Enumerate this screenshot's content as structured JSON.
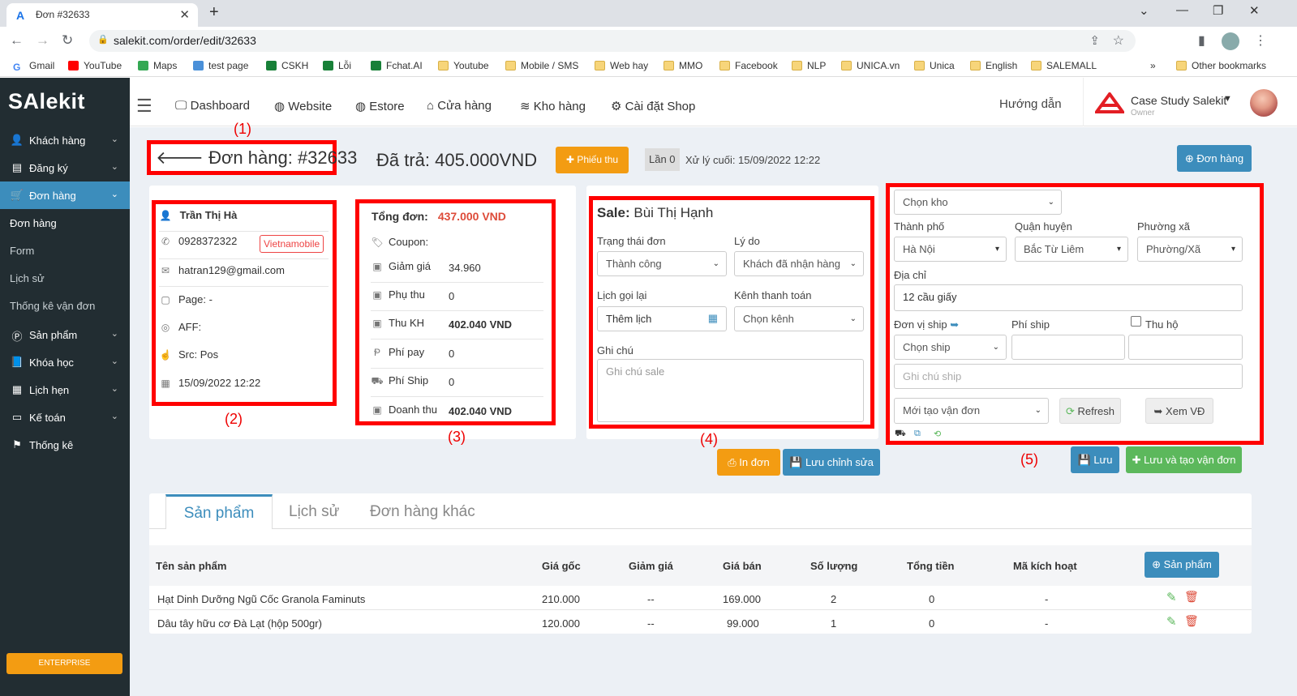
{
  "browser": {
    "tab_title": "Đơn #32633",
    "url": "salekit.com/order/edit/32633",
    "bookmarks": [
      "Gmail",
      "YouTube",
      "Maps",
      "test page",
      "CSKH",
      "Lỗi",
      "Fchat.AI",
      "Youtube",
      "Mobile / SMS",
      "Web hay",
      "MMO",
      "Facebook",
      "NLP",
      "UNICA.vn",
      "Unica",
      "English",
      "SALEMALL"
    ],
    "more": "»",
    "other_bookmarks": "Other bookmarks"
  },
  "sidebar": {
    "logo": "SAlekit",
    "items": [
      {
        "label": "Khách hàng",
        "icon": "user-icon"
      },
      {
        "label": "Đăng ký",
        "icon": "card-icon"
      },
      {
        "label": "Đơn hàng",
        "icon": "cart-icon"
      },
      {
        "label": "Sản phẩm",
        "icon": "product-icon"
      },
      {
        "label": "Khóa học",
        "icon": "book-icon"
      },
      {
        "label": "Lịch hẹn",
        "icon": "calendar-icon"
      },
      {
        "label": "Kế toán",
        "icon": "money-icon"
      },
      {
        "label": "Thống kê",
        "icon": "flag-icon"
      }
    ],
    "sub": [
      "Đơn hàng",
      "Form",
      "Lịch sử",
      "Thống kê vận đơn"
    ],
    "enterprise": "ENTERPRISE"
  },
  "topnav": {
    "items": [
      "Dashboard",
      "Website",
      "Estore",
      "Cửa hàng",
      "Kho hàng",
      "Cài đặt Shop"
    ],
    "guide": "Hướng dẫn",
    "user_name": "Case Study Salekit",
    "user_role": "Owner"
  },
  "header": {
    "order_title": "Đơn hàng: #32633",
    "paid": "Đã trả: 405.000VND",
    "receipt_btn": "Phiếu thu",
    "times": "Lần 0",
    "last_processed": "Xử lý cuối: 15/09/2022 12:22",
    "order_btn": "Đơn hàng"
  },
  "annotations": [
    "(1)",
    "(2)",
    "(3)",
    "(4)",
    "(5)"
  ],
  "customer": {
    "name": "Trần Thị Hà",
    "phone": "0928372322",
    "carrier": "Vietnamobile",
    "email": "hatran129@gmail.com",
    "page": "Page: -",
    "aff": "AFF:",
    "src": "Src: Pos",
    "date": "15/09/2022 12:22"
  },
  "totals": {
    "total_label": "Tổng đơn:",
    "total_value": "437.000 VND",
    "rows": [
      {
        "label": "Coupon:",
        "value": ""
      },
      {
        "label": "Giảm giá",
        "value": "34.960"
      },
      {
        "label": "Phụ thu",
        "value": "0"
      },
      {
        "label": "Thu KH",
        "value": "402.040 VND"
      },
      {
        "label": "Phí pay",
        "value": "0"
      },
      {
        "label": "Phí Ship",
        "value": "0"
      },
      {
        "label": "Doanh thu",
        "value": "402.040 VND"
      }
    ]
  },
  "sale": {
    "label": "Sale:",
    "name": "Bùi Thị Hạnh",
    "status_label": "Trạng thái đơn",
    "status": "Thành công",
    "reason_label": "Lý do",
    "reason": "Khách đã nhận hàng",
    "callback_label": "Lịch gọi lại",
    "callback": "Thêm lịch",
    "payment_label": "Kênh thanh toán",
    "payment": "Chọn kênh",
    "note_label": "Ghi chú",
    "note_placeholder": "Ghi chú sale",
    "print_btn": "In đơn",
    "save_btn": "Lưu chỉnh sửa"
  },
  "shipping": {
    "warehouse": "Chọn kho",
    "city_label": "Thành phố",
    "city": "Hà Nội",
    "district_label": "Quận huyện",
    "district": "Bắc Từ Liêm",
    "ward_label": "Phường xã",
    "ward": "Phường/Xã",
    "address_label": "Địa chỉ",
    "address": "12 cầu giấy",
    "carrier_label": "Đơn vị ship",
    "fee_label": "Phí ship",
    "cod_label": "Thu hộ",
    "carrier": "Chọn ship",
    "ship_note_placeholder": "Ghi chú ship",
    "waybill_status": "Mới tạo vận đơn",
    "refresh_btn": "Refresh",
    "view_btn": "Xem VĐ",
    "save_btn": "Lưu",
    "save_create_btn": "Lưu và tạo vận đơn"
  },
  "tabs": [
    "Sản phẩm",
    "Lịch sử",
    "Đơn hàng khác"
  ],
  "table": {
    "headers": [
      "Tên sản phẩm",
      "Giá gốc",
      "Giảm giá",
      "Giá bán",
      "Số lượng",
      "Tổng tiền",
      "Mã kích hoạt"
    ],
    "add_btn": "Sản phẩm",
    "rows": [
      [
        "Hạt Dinh Dưỡng Ngũ Cốc Granola Faminuts",
        "210.000",
        "--",
        "169.000",
        "2",
        "0",
        "-"
      ],
      [
        "Dâu tây hữu cơ Đà Lạt (hộp 500gr)",
        "120.000",
        "--",
        "99.000",
        "1",
        "0",
        "-"
      ]
    ]
  },
  "colors": {
    "sidebar": "#222d32",
    "active": "#3c8dbc",
    "primary": "#3c8dbc",
    "warning": "#f39c12",
    "success": "#5cb85c",
    "annotation": "#ff0000"
  }
}
